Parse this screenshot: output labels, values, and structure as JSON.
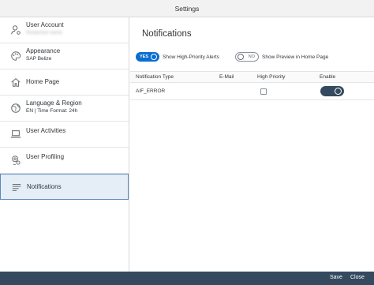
{
  "window": {
    "title": "Settings"
  },
  "sidebar": {
    "items": [
      {
        "label": "User Account",
        "sub": "Redacted name",
        "icon": "user-account-icon"
      },
      {
        "label": "Appearance",
        "sub": "SAP Belize",
        "icon": "palette-icon"
      },
      {
        "label": "Home Page",
        "sub": "",
        "icon": "home-icon"
      },
      {
        "label": "Language & Region",
        "sub": "EN | Time Format: 24h",
        "icon": "globe-icon"
      },
      {
        "label": "User Activities",
        "sub": "",
        "icon": "laptop-icon"
      },
      {
        "label": "User Profiling",
        "sub": "",
        "icon": "user-settings-icon"
      },
      {
        "label": "Notifications",
        "sub": "",
        "icon": "notification-list-icon",
        "selected": true
      }
    ]
  },
  "main": {
    "title": "Notifications",
    "high_priority_toggle": {
      "state": "YES",
      "label": "Show High-Priority Alerts"
    },
    "preview_toggle": {
      "state": "NO",
      "label": "Show Preview in Home Page"
    },
    "table": {
      "columns": [
        "Notification Type",
        "E-Mail",
        "High Priority",
        "Enable"
      ],
      "rows": [
        {
          "type": "AIF_ERROR",
          "email": "",
          "high_priority": false,
          "enabled": true
        }
      ]
    }
  },
  "footer": {
    "save_label": "Save",
    "close_label": "Close"
  },
  "colors": {
    "accent": "#0a6ed1",
    "shell": "#354a5f",
    "selected_bg": "#e5eef7"
  }
}
